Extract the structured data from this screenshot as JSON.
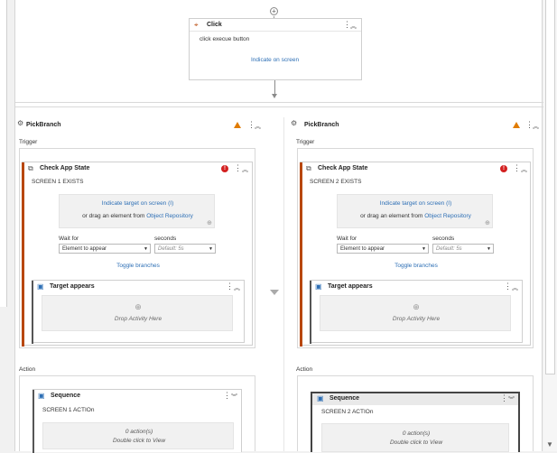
{
  "click_activity": {
    "title": "Click",
    "description": "click execue button",
    "indicate_link": "Indicate on screen"
  },
  "left_branch": {
    "title": "PickBranch",
    "trigger_label": "Trigger",
    "action_label": "Action",
    "check_app_state": {
      "title": "Check App State",
      "subtitle": "SCREEN 1 EXISTS",
      "indicate_link": "Indicate target on screen (I)",
      "drag_prefix": "or drag an element from",
      "object_repository": "Object Repository",
      "wait_for_label": "Wait for",
      "wait_for_value": "Element to appear",
      "seconds_label": "seconds",
      "seconds_placeholder": "Default: 5s",
      "toggle_branches": "Toggle branches",
      "target_appears": {
        "title": "Target appears",
        "drop_text": "Drop Activity Here"
      }
    },
    "sequence": {
      "title": "Sequence",
      "subtitle": "SCREEN 1 ACTIOn",
      "actions_count": "0 action(s)",
      "double_click_hint": "Double click to View"
    }
  },
  "right_branch": {
    "title": "PickBranch",
    "trigger_label": "Trigger",
    "action_label": "Action",
    "check_app_state": {
      "title": "Check App State",
      "subtitle": "SCREEN 2 EXISTS",
      "indicate_link": "Indicate target on screen (I)",
      "drag_prefix": "or drag an element from",
      "object_repository": "Object Repository",
      "wait_for_label": "Wait for",
      "wait_for_value": "Element to appear",
      "seconds_label": "seconds",
      "seconds_placeholder": "Default: 5s",
      "toggle_branches": "Toggle branches",
      "target_appears": {
        "title": "Target appears",
        "drop_text": "Drop Activity Here"
      }
    },
    "sequence": {
      "title": "Sequence",
      "subtitle": "SCREEN  2  ACTIOn",
      "actions_count": "0 action(s)",
      "double_click_hint": "Double click to View"
    }
  },
  "colors": {
    "link": "#2d6fb5",
    "warning": "#e07b00",
    "error": "#d32020",
    "activity_accent": "#b8470a"
  }
}
